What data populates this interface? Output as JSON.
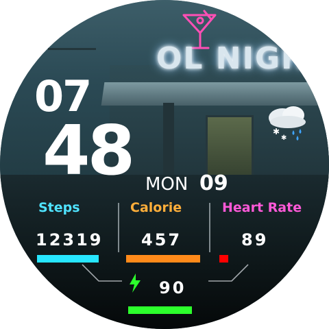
{
  "background": {
    "neon_sign": "OL NIGH"
  },
  "time": {
    "hour": "07",
    "minute": "48"
  },
  "date": {
    "day_of_week": "MON",
    "day": "09"
  },
  "weather": {
    "icon": "snow-rain-cloud-icon"
  },
  "stats": {
    "steps": {
      "label": "Steps",
      "value": "12319",
      "color": "#27e6ff"
    },
    "calorie": {
      "label": "Calorie",
      "value": "457",
      "color": "#ff8a1a"
    },
    "heart_rate": {
      "label": "Heart Rate",
      "value": "89",
      "color": "#ff0000"
    }
  },
  "battery": {
    "icon": "lightning-bolt-icon",
    "value": "90",
    "color": "#2cff2c"
  },
  "colors": {
    "steps_label": "#4fe3ff",
    "calorie_label": "#ffae3a",
    "heart_rate_label": "#ff59d8",
    "neon_glass": "#ff4fb5"
  }
}
